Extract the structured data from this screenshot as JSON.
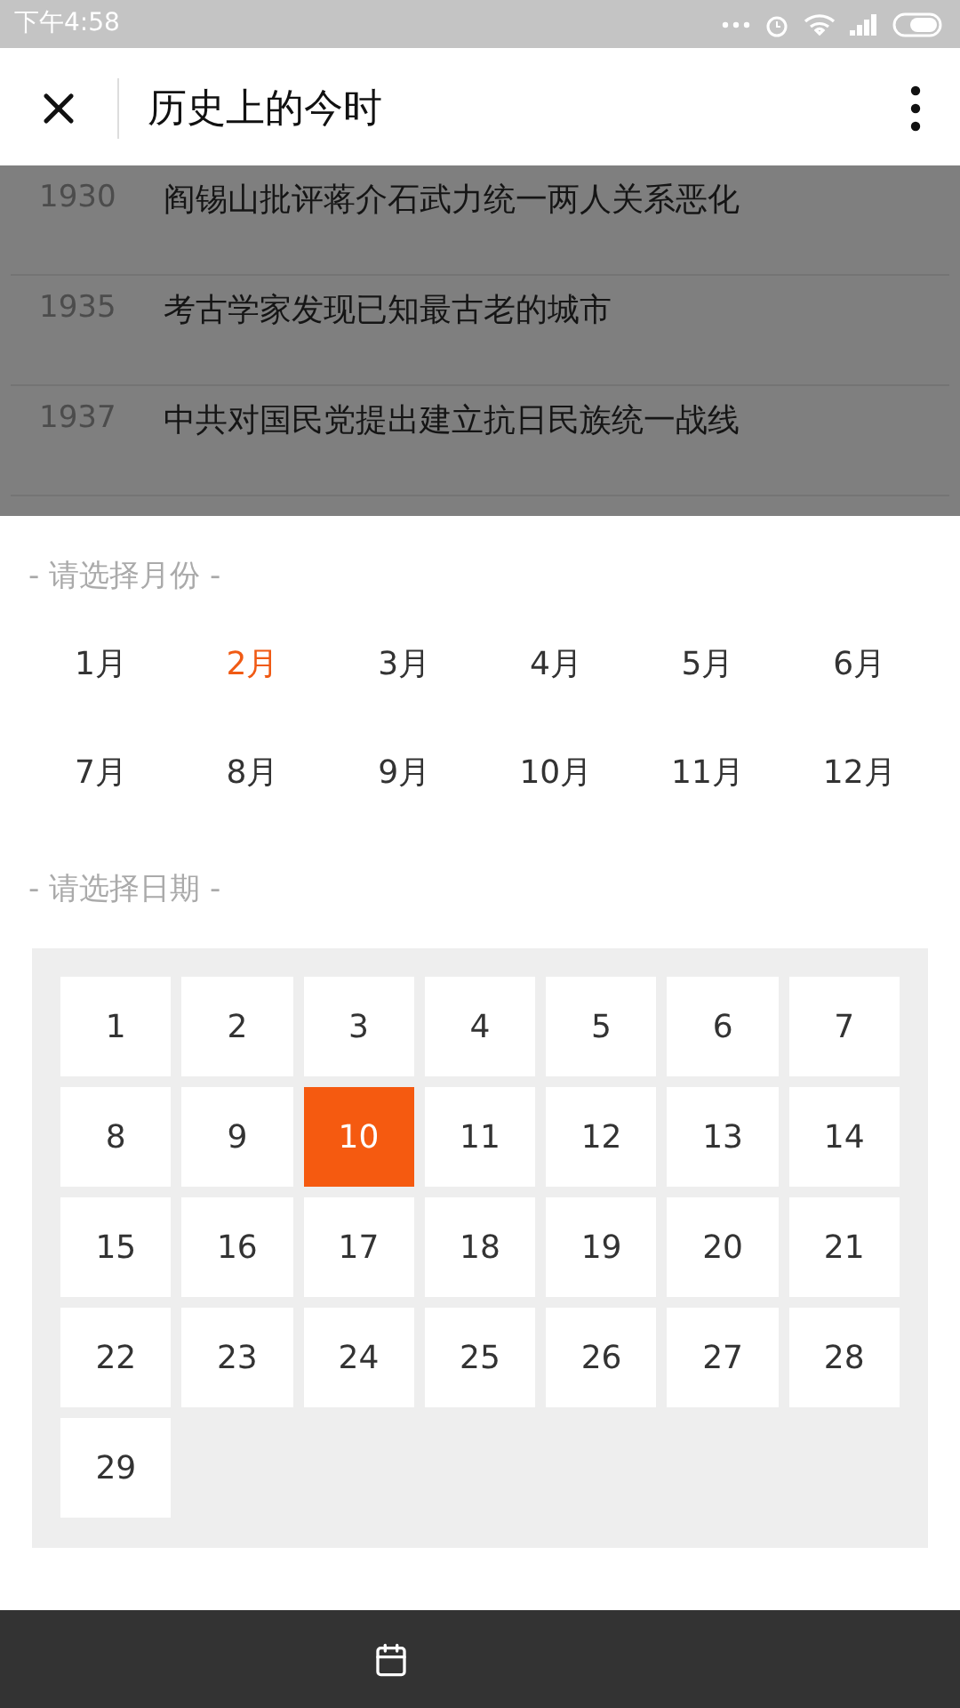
{
  "status_bar": {
    "time": "下午4:58"
  },
  "header": {
    "title": "历史上的今时"
  },
  "events": [
    {
      "year": "1930",
      "title": "阎锡山批评蒋介石武力统一两人关系恶化"
    },
    {
      "year": "1935",
      "title": "考古学家发现已知最古老的城市"
    },
    {
      "year": "1937",
      "title": "中共对国民党提出建立抗日民族统一战线"
    }
  ],
  "month_picker": {
    "label": "- 请选择月份 -",
    "months": [
      {
        "label": "1月",
        "selected": false
      },
      {
        "label": "2月",
        "selected": true
      },
      {
        "label": "3月",
        "selected": false
      },
      {
        "label": "4月",
        "selected": false
      },
      {
        "label": "5月",
        "selected": false
      },
      {
        "label": "6月",
        "selected": false
      },
      {
        "label": "7月",
        "selected": false
      },
      {
        "label": "8月",
        "selected": false
      },
      {
        "label": "9月",
        "selected": false
      },
      {
        "label": "10月",
        "selected": false
      },
      {
        "label": "11月",
        "selected": false
      },
      {
        "label": "12月",
        "selected": false
      }
    ]
  },
  "day_picker": {
    "label": "- 请选择日期 -",
    "days": [
      {
        "label": "1",
        "selected": false
      },
      {
        "label": "2",
        "selected": false
      },
      {
        "label": "3",
        "selected": false
      },
      {
        "label": "4",
        "selected": false
      },
      {
        "label": "5",
        "selected": false
      },
      {
        "label": "6",
        "selected": false
      },
      {
        "label": "7",
        "selected": false
      },
      {
        "label": "8",
        "selected": false
      },
      {
        "label": "9",
        "selected": false
      },
      {
        "label": "10",
        "selected": true
      },
      {
        "label": "11",
        "selected": false
      },
      {
        "label": "12",
        "selected": false
      },
      {
        "label": "13",
        "selected": false
      },
      {
        "label": "14",
        "selected": false
      },
      {
        "label": "15",
        "selected": false
      },
      {
        "label": "16",
        "selected": false
      },
      {
        "label": "17",
        "selected": false
      },
      {
        "label": "18",
        "selected": false
      },
      {
        "label": "19",
        "selected": false
      },
      {
        "label": "20",
        "selected": false
      },
      {
        "label": "21",
        "selected": false
      },
      {
        "label": "22",
        "selected": false
      },
      {
        "label": "23",
        "selected": false
      },
      {
        "label": "24",
        "selected": false
      },
      {
        "label": "25",
        "selected": false
      },
      {
        "label": "26",
        "selected": false
      },
      {
        "label": "27",
        "selected": false
      },
      {
        "label": "28",
        "selected": false
      },
      {
        "label": "29",
        "selected": false
      }
    ]
  }
}
